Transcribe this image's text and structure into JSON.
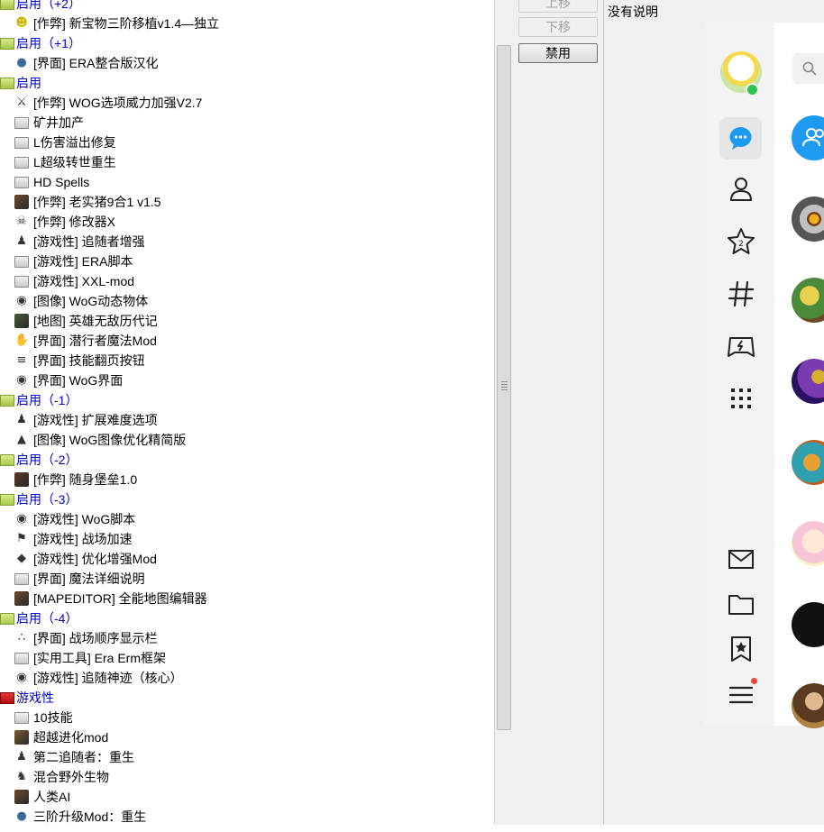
{
  "mod_tree": [
    {
      "type": "group",
      "label": "启用（+2）",
      "icon": "green-folder-icon"
    },
    {
      "type": "item",
      "label": "[作弊] 新宝物三阶移植v1.4—独立",
      "icon": "smiley-icon"
    },
    {
      "type": "group",
      "label": "启用（+1）",
      "icon": "green-folder-icon"
    },
    {
      "type": "item",
      "label": "[界面] ERA整合版汉化",
      "icon": "globe-icon"
    },
    {
      "type": "group",
      "label": "启用",
      "icon": "green-folder-icon"
    },
    {
      "type": "item",
      "label": "[作弊] WOG选项威力加强V2.7",
      "icon": "sword-icon"
    },
    {
      "type": "item",
      "label": "矿井加产",
      "icon": "folder-icon"
    },
    {
      "type": "item",
      "label": "L伤害溢出修复",
      "icon": "folder-icon"
    },
    {
      "type": "item",
      "label": "L超级转世重生",
      "icon": "folder-icon"
    },
    {
      "type": "item",
      "label": "HD Spells",
      "icon": "folder-icon"
    },
    {
      "type": "item",
      "label": "[作弊] 老实猪9合1 v1.5",
      "icon": "picture-icon"
    },
    {
      "type": "item",
      "label": "[作弊] 修改器X",
      "icon": "skull-icon"
    },
    {
      "type": "item",
      "label": "[游戏性] 追随者增强",
      "icon": "figure-icon"
    },
    {
      "type": "item",
      "label": "[游戏性] ERA脚本",
      "icon": "folder-icon"
    },
    {
      "type": "item",
      "label": "[游戏性] XXL-mod",
      "icon": "folder-icon"
    },
    {
      "type": "item",
      "label": "[图像] WoG动态物体",
      "icon": "eye-icon"
    },
    {
      "type": "item",
      "label": "[地图] 英雄无敌历代记",
      "icon": "picture-icon"
    },
    {
      "type": "item",
      "label": "[界面] 潜行者魔法Mod",
      "icon": "hand-icon"
    },
    {
      "type": "item",
      "label": "[界面] 技能翻页按钮",
      "icon": "bars-icon"
    },
    {
      "type": "item",
      "label": "[界面] WoG界面",
      "icon": "eye-icon"
    },
    {
      "type": "group",
      "label": "启用（-1）",
      "icon": "green-folder-icon"
    },
    {
      "type": "item",
      "label": "[游戏性] 扩展难度选项",
      "icon": "figure-icon"
    },
    {
      "type": "item",
      "label": "[图像] WoG图像优化精简版",
      "icon": "tent-icon"
    },
    {
      "type": "group",
      "label": "启用（-2）",
      "icon": "green-folder-icon"
    },
    {
      "type": "item",
      "label": "[作弊] 随身堡垒1.0",
      "icon": "picture-icon"
    },
    {
      "type": "group",
      "label": "启用（-3）",
      "icon": "green-folder-icon"
    },
    {
      "type": "item",
      "label": "[游戏性] WoG脚本",
      "icon": "eye-icon"
    },
    {
      "type": "item",
      "label": "[游戏性] 战场加速",
      "icon": "runner-icon"
    },
    {
      "type": "item",
      "label": "[游戏性] 优化增强Mod",
      "icon": "gem-icon"
    },
    {
      "type": "item",
      "label": "[界面] 魔法详细说明",
      "icon": "folder-icon"
    },
    {
      "type": "item",
      "label": "[MAPEDITOR] 全能地图编辑器",
      "icon": "picture-icon"
    },
    {
      "type": "group",
      "label": "启用（-4）",
      "icon": "green-folder-icon"
    },
    {
      "type": "item",
      "label": "[界面] 战场顺序显示栏",
      "icon": "dots-icon"
    },
    {
      "type": "item",
      "label": "[实用工具] Era Erm框架",
      "icon": "folder-icon"
    },
    {
      "type": "item",
      "label": "[游戏性] 追随神迹（核心）",
      "icon": "eye-icon"
    },
    {
      "type": "group",
      "label": "游戏性",
      "icon": "red-folder-icon"
    },
    {
      "type": "item",
      "label": "10技能",
      "icon": "folder-icon"
    },
    {
      "type": "item",
      "label": "超越进化mod",
      "icon": "picture-icon"
    },
    {
      "type": "item",
      "label": "第二追随者：重生",
      "icon": "figure-icon"
    },
    {
      "type": "item",
      "label": "混合野外生物",
      "icon": "creature-icon"
    },
    {
      "type": "item",
      "label": "人类AI",
      "icon": "picture-icon"
    },
    {
      "type": "item",
      "label": "三阶升级Mod：重生",
      "icon": "globe-icon"
    }
  ],
  "buttons": {
    "move_up": "上移",
    "move_down": "下移",
    "disable": "禁用"
  },
  "description": "没有说明",
  "qq": {
    "nav_icons": [
      "profile-avatar",
      "chat-icon",
      "contacts-icon",
      "favorites-star-icon",
      "channel-hash-icon",
      "game-icon",
      "apps-grid-icon",
      "mail-icon",
      "folder-icon",
      "bookmark-star-icon",
      "menu-icon"
    ],
    "search_icon": "search-icon",
    "accent_color": "#1e9bf0",
    "online_color": "#2ac34c",
    "badge_color": "#f44336"
  }
}
